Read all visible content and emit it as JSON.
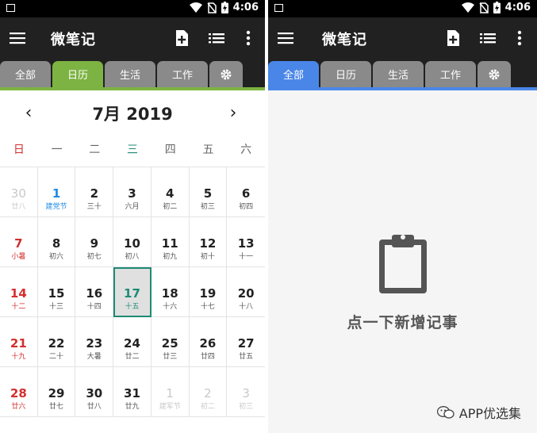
{
  "status": {
    "time": "4:06"
  },
  "app": {
    "title": "微笔记"
  },
  "tabs": [
    "全部",
    "日历",
    "生活",
    "工作"
  ],
  "colors": {
    "calendar_tab": "#7cb342",
    "all_tab": "#4a86e8",
    "today": "#1e8a74",
    "sunday": "#d32f2f",
    "holiday": "#1e88e5"
  },
  "calendar": {
    "month_title": "7月 2019",
    "prev": "‹",
    "next": "›",
    "weekdays": [
      "日",
      "一",
      "二",
      "三",
      "四",
      "五",
      "六"
    ],
    "days": [
      {
        "n": "30",
        "s": "廿八",
        "t": "other"
      },
      {
        "n": "1",
        "s": "建党节",
        "t": "holiday"
      },
      {
        "n": "2",
        "s": "三十",
        "t": ""
      },
      {
        "n": "3",
        "s": "六月",
        "t": ""
      },
      {
        "n": "4",
        "s": "初二",
        "t": ""
      },
      {
        "n": "5",
        "s": "初三",
        "t": ""
      },
      {
        "n": "6",
        "s": "初四",
        "t": ""
      },
      {
        "n": "7",
        "s": "小暑",
        "t": "sun"
      },
      {
        "n": "8",
        "s": "初六",
        "t": ""
      },
      {
        "n": "9",
        "s": "初七",
        "t": ""
      },
      {
        "n": "10",
        "s": "初八",
        "t": ""
      },
      {
        "n": "11",
        "s": "初九",
        "t": ""
      },
      {
        "n": "12",
        "s": "初十",
        "t": ""
      },
      {
        "n": "13",
        "s": "十一",
        "t": ""
      },
      {
        "n": "14",
        "s": "十二",
        "t": "sun"
      },
      {
        "n": "15",
        "s": "十三",
        "t": ""
      },
      {
        "n": "16",
        "s": "十四",
        "t": ""
      },
      {
        "n": "17",
        "s": "十五",
        "t": "selected"
      },
      {
        "n": "18",
        "s": "十六",
        "t": ""
      },
      {
        "n": "19",
        "s": "十七",
        "t": ""
      },
      {
        "n": "20",
        "s": "十八",
        "t": ""
      },
      {
        "n": "21",
        "s": "十九",
        "t": "sun"
      },
      {
        "n": "22",
        "s": "二十",
        "t": ""
      },
      {
        "n": "23",
        "s": "大暑",
        "t": ""
      },
      {
        "n": "24",
        "s": "廿二",
        "t": ""
      },
      {
        "n": "25",
        "s": "廿三",
        "t": ""
      },
      {
        "n": "26",
        "s": "廿四",
        "t": ""
      },
      {
        "n": "27",
        "s": "廿五",
        "t": ""
      },
      {
        "n": "28",
        "s": "廿六",
        "t": "sun"
      },
      {
        "n": "29",
        "s": "廿七",
        "t": ""
      },
      {
        "n": "30",
        "s": "廿八",
        "t": ""
      },
      {
        "n": "31",
        "s": "廿九",
        "t": ""
      },
      {
        "n": "1",
        "s": "建军节",
        "t": "other"
      },
      {
        "n": "2",
        "s": "初二",
        "t": "other"
      },
      {
        "n": "3",
        "s": "初三",
        "t": "other"
      }
    ]
  },
  "empty": {
    "message": "点一下新增记事"
  },
  "watermark": {
    "text": "APP优选集"
  }
}
